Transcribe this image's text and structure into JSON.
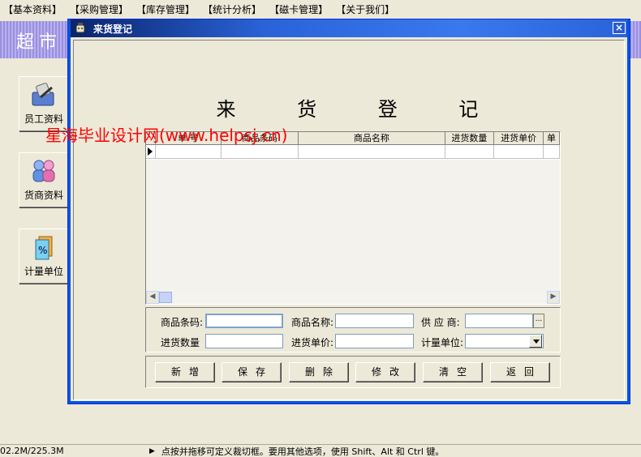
{
  "menubar": {
    "items": [
      "【基本资料】",
      "【采购管理】",
      "【库存管理】",
      "【统计分析】",
      "【磁卡管理】",
      "【关于我们】"
    ]
  },
  "background": {
    "title": "超市"
  },
  "sidebar": {
    "buttons": [
      {
        "label": "员工资料",
        "icon": "employee-icon"
      },
      {
        "label": "货商资料",
        "icon": "supplier-icon"
      },
      {
        "label": "计量单位",
        "icon": "unit-icon"
      }
    ]
  },
  "window": {
    "title": "来货登记",
    "close_label": "×"
  },
  "form": {
    "title": "来 货 登 记"
  },
  "grid": {
    "columns": [
      "",
      "单  号",
      "商品条码",
      "商品名称",
      "进货数量",
      "进货单价",
      "单"
    ]
  },
  "fields": {
    "barcode_label": "商品条码:",
    "name_label": "商品名称:",
    "supplier_label": "供 应 商:",
    "qty_label": "进货数量",
    "price_label": "进货单价:",
    "unit_label": "计量单位:",
    "ellipsis": "..."
  },
  "buttons": {
    "add": "新增",
    "save": "保存",
    "delete": "删除",
    "modify": "修改",
    "clear": "清空",
    "back": "返回"
  },
  "watermark": "星海毕业设计网(www.helpsj.cn)",
  "status": {
    "memory": "02.2M/225.3M",
    "tip": "点按并拖移可定义裁切框。要用其他选项，使用 Shift、Alt 和 Ctrl 键。"
  },
  "colors": {
    "titlebar": "#0055E5",
    "watermark": "#FF0000",
    "face": "#ECE9D8"
  }
}
